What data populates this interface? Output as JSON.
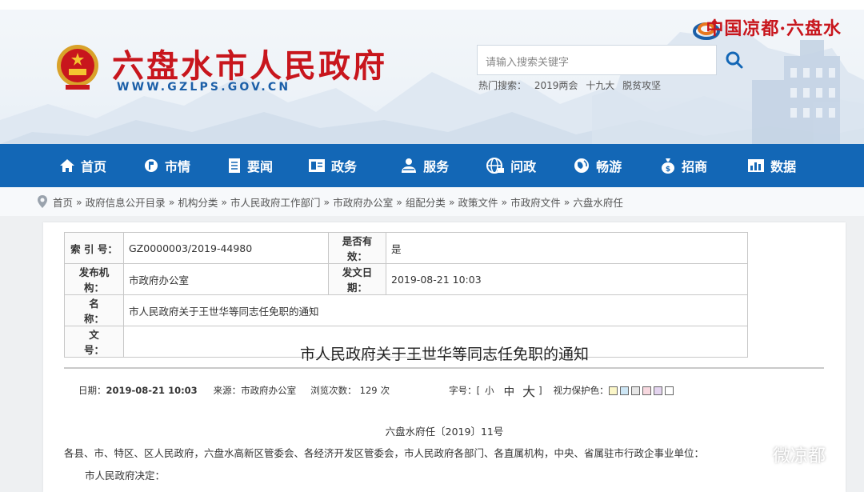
{
  "header": {
    "site_title": "六盘水市人民政府",
    "site_url": "WWW.GZLPS.GOV.CN",
    "brand": "中国凉都·六盘水",
    "search_placeholder": "请输入搜索关键字",
    "hot_label": "热门搜索：",
    "hot_terms": [
      "2019两会",
      "十九大",
      "脱贫攻坚"
    ]
  },
  "nav": [
    {
      "label": "首页",
      "icon": "home-icon"
    },
    {
      "label": "市情",
      "icon": "city-icon"
    },
    {
      "label": "要闻",
      "icon": "news-icon"
    },
    {
      "label": "政务",
      "icon": "government-icon"
    },
    {
      "label": "服务",
      "icon": "service-icon"
    },
    {
      "label": "问政",
      "icon": "inquiry-icon"
    },
    {
      "label": "畅游",
      "icon": "travel-icon"
    },
    {
      "label": "招商",
      "icon": "investment-icon"
    },
    {
      "label": "数据",
      "icon": "data-icon"
    }
  ],
  "breadcrumb": [
    "首页",
    "政府信息公开目录",
    "机构分类",
    "市人民政府工作部门",
    "市政府办公室",
    "组配分类",
    "政策文件",
    "市政府文件",
    "六盘水府任"
  ],
  "meta": {
    "index_label": "索 引 号：",
    "index_value": "GZ0000003/2019-44980",
    "valid_label": "是否有效：",
    "valid_value": "是",
    "issuer_label": "发布机构：",
    "issuer_value": "市政府办公室",
    "date_label": "发文日期：",
    "date_value": "2019-08-21 10:03",
    "name_label": "名　　称：",
    "name_value": "市人民政府关于王世华等同志任免职的通知",
    "docnum_label": "文　　号：",
    "docnum_value": ""
  },
  "article": {
    "title": "市人民政府关于王世华等同志任免职的通知",
    "date_label": "日期：",
    "date_value": "2019-08-21 10:03",
    "source_label": "来源：",
    "source_value": "市政府办公室",
    "views_label": "浏览次数：",
    "views_value": "129",
    "views_unit": "次",
    "fontsize_label": "字号：",
    "fontsize_open": "[",
    "fontsize_small": "小",
    "fontsize_medium": "中",
    "fontsize_large": "大",
    "fontsize_close": "]",
    "eye_label": "视力保护色：",
    "eye_colors": [
      "#fbf6c8",
      "#cde6f5",
      "#e6e6e6",
      "#f7d8df",
      "#e4d4ef",
      "#ffffff"
    ],
    "doc_number": "六盘水府任〔2019〕11号",
    "para1": "各县、市、特区、区人民政府，六盘水高新区管委会、各经济开发区管委会，市人民政府各部门、各直属机构，中央、省属驻市行政企事业单位：",
    "para2": "市人民政府决定："
  },
  "watermark": "微凉都",
  "colors": {
    "nav_bg": "#1367b6",
    "title_red": "#c8161d",
    "url_blue": "#1b5fa8"
  }
}
